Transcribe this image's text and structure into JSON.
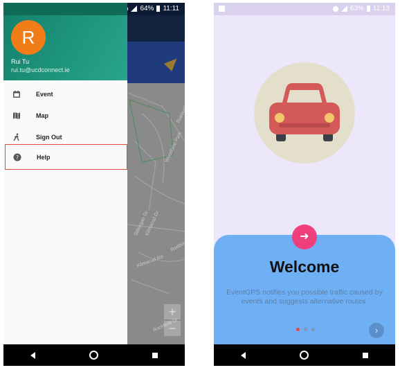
{
  "left_screen": {
    "status": {
      "battery": "64%",
      "time": "11:11"
    },
    "user": {
      "initial": "R",
      "name": "Rui Tu",
      "email": "rui.tu@ucdconnect.ie"
    },
    "menu": [
      {
        "label": "Event",
        "icon": "calendar-icon"
      },
      {
        "label": "Map",
        "icon": "map-icon"
      },
      {
        "label": "Sign Out",
        "icon": "walk-icon"
      },
      {
        "label": "Help",
        "icon": "help-icon"
      }
    ],
    "map": {
      "zoom_in": "+",
      "zoom_out": "−",
      "streets": [
        "Roebuck Park",
        "Woodbine Park",
        "Kilmacud Rd",
        "Stillorgan Gr",
        "Kilmacud Gr",
        "Rockfield Dr",
        "Roebuck Dr"
      ]
    }
  },
  "right_screen": {
    "status": {
      "battery": "63%",
      "time": "11:13"
    },
    "title": "Welcome",
    "description": "EventGPS notifies you possible traffic caused by events and suggests alternative routes.",
    "page_count": 3,
    "active_page": 1,
    "accent_color": "#ef3f7c"
  }
}
